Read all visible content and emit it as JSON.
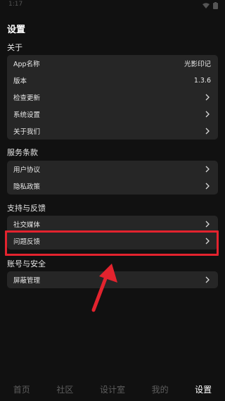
{
  "status": {
    "time": "1:17"
  },
  "page": {
    "title": "设置"
  },
  "sections": [
    {
      "title": "关于",
      "rows": [
        {
          "label": "App名称",
          "value": "光影印记",
          "chevron": false
        },
        {
          "label": "版本",
          "value": "1.3.6",
          "chevron": false
        },
        {
          "label": "检查更新",
          "value": "",
          "chevron": true
        },
        {
          "label": "系统设置",
          "value": "",
          "chevron": true
        },
        {
          "label": "关于我们",
          "value": "",
          "chevron": true
        }
      ]
    },
    {
      "title": "服务条款",
      "rows": [
        {
          "label": "用户协议",
          "chevron": true
        },
        {
          "label": "隐私政策",
          "chevron": true
        }
      ]
    },
    {
      "title": "支持与反馈",
      "rows": [
        {
          "label": "社交媒体",
          "chevron": true
        },
        {
          "label": "问题反馈",
          "chevron": true
        }
      ]
    },
    {
      "title": "账号与安全",
      "rows": [
        {
          "label": "屏蔽管理",
          "chevron": true
        }
      ]
    }
  ],
  "tabs": [
    {
      "label": "首页",
      "active": false
    },
    {
      "label": "社区",
      "active": false
    },
    {
      "label": "设计室",
      "active": false
    },
    {
      "label": "我的",
      "active": false
    },
    {
      "label": "设置",
      "active": true
    }
  ],
  "colors": {
    "background": "#111111",
    "card": "#262626",
    "highlight": "#e3232e",
    "tab_inactive": "#5e5e5e",
    "tab_active": "#ffffff"
  },
  "icons": [
    "wifi-icon",
    "battery-icon",
    "chevron-right-icon",
    "annotation-arrow-icon"
  ]
}
